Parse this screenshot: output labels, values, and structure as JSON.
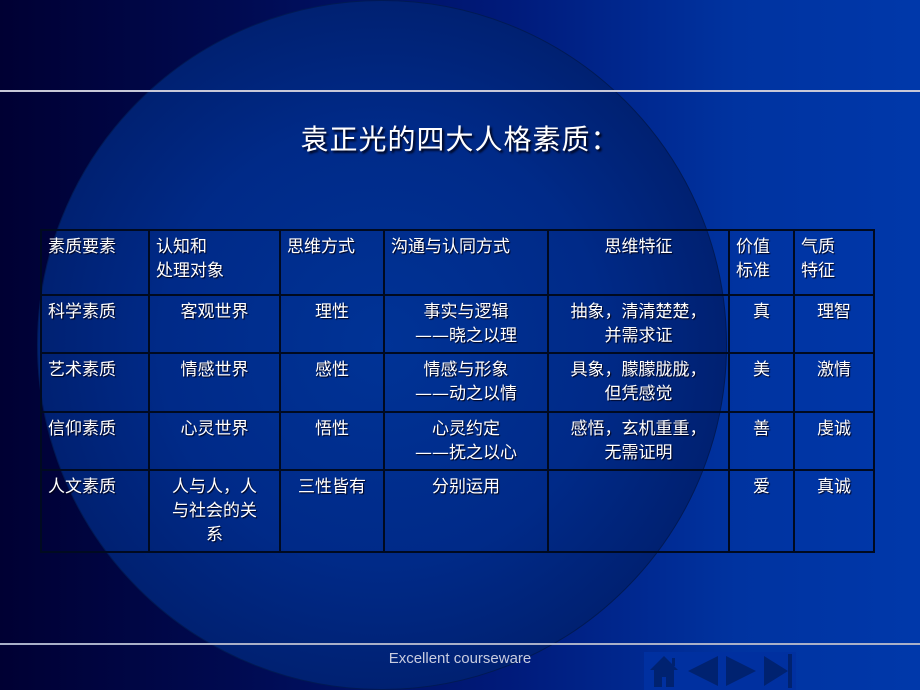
{
  "slide": {
    "title": "袁正光的四大人格素质：",
    "footer": "Excellent courseware"
  },
  "table": {
    "headers": [
      "素质要素",
      "认知和\n处理对象",
      "思维方式",
      "沟通与认同方式",
      "思维特征",
      "价值\n标准",
      "气质\n特征"
    ],
    "header_lines": [
      [
        "素质要素"
      ],
      [
        "认知和",
        "处理对象"
      ],
      [
        "思维方式"
      ],
      [
        "沟通与认同方式"
      ],
      [
        "思维特征"
      ],
      [
        "价值",
        "标准"
      ],
      [
        "气质",
        "特征"
      ]
    ],
    "rows": [
      {
        "element": "科学素质",
        "object": "客观世界",
        "thinking": "理性",
        "communication": [
          "事实与逻辑",
          "——晓之以理"
        ],
        "feature": [
          "抽象，清清楚楚，",
          "并需求证"
        ],
        "value": "真",
        "temperament": "理智"
      },
      {
        "element": "艺术素质",
        "object": "情感世界",
        "thinking": "感性",
        "communication": [
          "情感与形象",
          "——动之以情"
        ],
        "feature": [
          "具象，朦朦胧胧，",
          "但凭感觉"
        ],
        "value": "美",
        "temperament": "激情"
      },
      {
        "element": "信仰素质",
        "object": "心灵世界",
        "thinking": "悟性",
        "communication": [
          "心灵约定",
          "——抚之以心"
        ],
        "feature": [
          "感悟，玄机重重，",
          "无需证明"
        ],
        "value": "善",
        "temperament": "虔诚"
      },
      {
        "element": "人文素质",
        "object": [
          "人与人，人",
          "与社会的关",
          "系"
        ],
        "thinking": "三性皆有",
        "communication": [
          "分别运用"
        ],
        "feature": [],
        "value": "爱",
        "temperament": "真诚"
      }
    ]
  },
  "navigation": {
    "buttons": [
      {
        "name": "home",
        "icon": "home-icon"
      },
      {
        "name": "previous",
        "icon": "triangle-left-icon"
      },
      {
        "name": "next",
        "icon": "triangle-right-icon"
      },
      {
        "name": "last",
        "icon": "skip-end-icon"
      }
    ],
    "icon_color": "#002270"
  },
  "colors": {
    "background_left": "#000033",
    "background_right": "#0038aa",
    "text": "#ffffff",
    "rule_line": "#c8c8d8"
  }
}
